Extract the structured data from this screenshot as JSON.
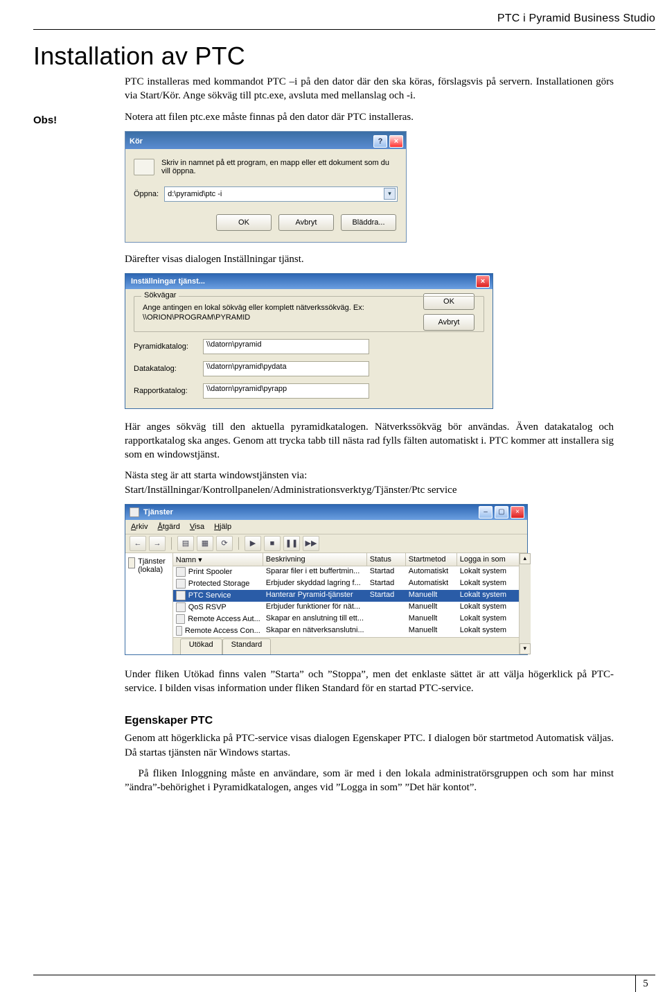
{
  "header": {
    "running_title": "PTC i Pyramid Business Studio"
  },
  "footer": {
    "page_number": "5"
  },
  "title": "Installation av PTC",
  "p1": "PTC installeras med kommandot PTC –i på den dator där den ska köras, förslagsvis på servern. Installationen görs via Start/Kör. Ange sökväg till ptc.exe, avsluta med mellanslag och -i.",
  "obs_label": "Obs!",
  "p2": "Notera att filen ptc.exe måste finnas på den dator där PTC installeras.",
  "run_dlg": {
    "title": "Kör",
    "help_text": "Skriv in namnet på ett program, en mapp eller ett dokument som du vill öppna.",
    "open_label": "Öppna:",
    "open_value": "d:\\pyramid\\ptc -i",
    "ok": "OK",
    "cancel": "Avbryt",
    "browse": "Bläddra..."
  },
  "p3": "Därefter visas dialogen Inställningar tjänst.",
  "set_dlg": {
    "title": "Inställningar tjänst...",
    "group_label": "Sökvägar",
    "desc": "Ange antingen en lokal sökväg eller komplett nätverkssökväg. Ex: \\\\ORION\\PROGRAM\\PYRAMID",
    "ok": "OK",
    "cancel": "Avbryt",
    "rows": [
      {
        "label": "Pyramidkatalog:",
        "value": "\\\\datorn\\pyramid"
      },
      {
        "label": "Datakatalog:",
        "value": "\\\\datorn\\pyramid\\pydata"
      },
      {
        "label": "Rapportkatalog:",
        "value": "\\\\datorn\\pyramid\\pyrapp"
      }
    ]
  },
  "p4": "Här anges sökväg till den aktuella pyramidkatalogen. Nätverkssökväg bör användas. Även datakatalog och rapportkatalog ska anges. Genom att trycka tabb till nästa rad fylls fälten automatiskt i. PTC kommer att installera sig som en windowstjänst.",
  "p5a": "Nästa steg är att starta windowstjänsten via:",
  "p5b": "Start/Inställningar/Kontrollpanelen/Administrationsverktyg/Tjänster/Ptc service",
  "svc": {
    "title": "Tjänster",
    "menu": {
      "arkiv": "Arkiv",
      "atgard": "Åtgärd",
      "visa": "Visa",
      "hjalp": "Hjälp"
    },
    "left_label": "Tjänster (lokala)",
    "cols": {
      "name": "Namn",
      "desc": "Beskrivning",
      "status": "Status",
      "start": "Startmetod",
      "logon": "Logga in som"
    },
    "rows": [
      {
        "name": "Print Spooler",
        "desc": "Sparar filer i ett buffertmin...",
        "status": "Startad",
        "start": "Automatiskt",
        "logon": "Lokalt system"
      },
      {
        "name": "Protected Storage",
        "desc": "Erbjuder skyddad lagring f...",
        "status": "Startad",
        "start": "Automatiskt",
        "logon": "Lokalt system"
      },
      {
        "name": "PTC Service",
        "desc": "Hanterar Pyramid-tjänster",
        "status": "Startad",
        "start": "Manuellt",
        "logon": "Lokalt system",
        "selected": true
      },
      {
        "name": "QoS RSVP",
        "desc": "Erbjuder funktioner för nät...",
        "status": "",
        "start": "Manuellt",
        "logon": "Lokalt system"
      },
      {
        "name": "Remote Access Aut...",
        "desc": "Skapar en anslutning till ett...",
        "status": "",
        "start": "Manuellt",
        "logon": "Lokalt system"
      },
      {
        "name": "Remote Access Con...",
        "desc": "Skapar en nätverksanslutni...",
        "status": "",
        "start": "Manuellt",
        "logon": "Lokalt system"
      }
    ],
    "tabs": {
      "ext": "Utökad",
      "std": "Standard"
    }
  },
  "p6": "Under fliken Utökad finns valen ”Starta” och ”Stoppa”, men det enklaste sättet är att välja högerklick på PTC-service. I bilden visas information under fliken Standard för en startad PTC-service.",
  "sub1": "Egenskaper PTC",
  "p7": "Genom att högerklicka på PTC-service visas dialogen Egenskaper PTC. I dialogen bör startmetod Automatisk väljas. Då startas tjänsten när Windows startas.",
  "p8": "På fliken Inloggning måste en användare, som är med i den lokala administratörsgruppen och som har minst ”ändra”-behörighet i Pyramidkatalogen, anges vid ”Logga in som” ”Det här kontot”."
}
